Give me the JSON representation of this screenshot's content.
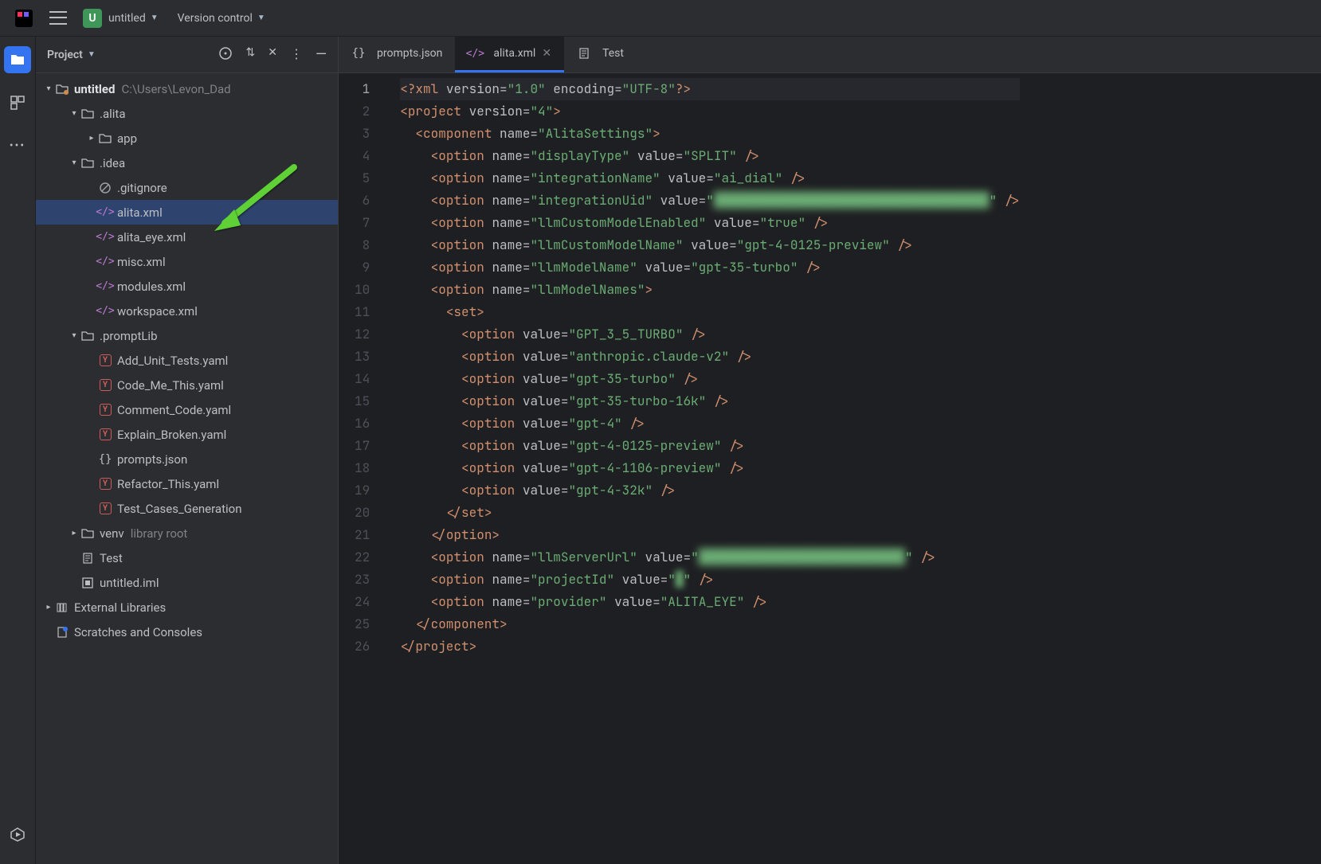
{
  "title": {
    "project": "untitled",
    "vcs": "Version control"
  },
  "leftbar": {
    "projectIcon": "folder-icon",
    "componentsIcon": "modules-icon",
    "moreIcon": "more-icon",
    "servicesIcon": "services-icon"
  },
  "panel": {
    "title": "Project"
  },
  "tree": {
    "root": {
      "label": "untitled",
      "hint": "C:\\Users\\Levon_Dad"
    },
    "items": [
      {
        "depth": 1,
        "arrow": "down",
        "icon": "folder",
        "label": ".alita"
      },
      {
        "depth": 2,
        "arrow": "right",
        "icon": "folder",
        "label": "app"
      },
      {
        "depth": 1,
        "arrow": "down",
        "icon": "folder",
        "label": ".idea"
      },
      {
        "depth": 2,
        "arrow": "",
        "icon": "ban",
        "label": ".gitignore"
      },
      {
        "depth": 2,
        "arrow": "",
        "icon": "xml",
        "label": "alita.xml",
        "selected": true
      },
      {
        "depth": 2,
        "arrow": "",
        "icon": "xml",
        "label": "alita_eye.xml"
      },
      {
        "depth": 2,
        "arrow": "",
        "icon": "xml",
        "label": "misc.xml"
      },
      {
        "depth": 2,
        "arrow": "",
        "icon": "xml",
        "label": "modules.xml"
      },
      {
        "depth": 2,
        "arrow": "",
        "icon": "xml",
        "label": "workspace.xml"
      },
      {
        "depth": 1,
        "arrow": "down",
        "icon": "folder",
        "label": ".promptLib"
      },
      {
        "depth": 2,
        "arrow": "",
        "icon": "yaml",
        "label": "Add_Unit_Tests.yaml"
      },
      {
        "depth": 2,
        "arrow": "",
        "icon": "yaml",
        "label": "Code_Me_This.yaml"
      },
      {
        "depth": 2,
        "arrow": "",
        "icon": "yaml",
        "label": "Comment_Code.yaml"
      },
      {
        "depth": 2,
        "arrow": "",
        "icon": "yaml",
        "label": "Explain_Broken.yaml"
      },
      {
        "depth": 2,
        "arrow": "",
        "icon": "json",
        "label": "prompts.json"
      },
      {
        "depth": 2,
        "arrow": "",
        "icon": "yaml",
        "label": "Refactor_This.yaml"
      },
      {
        "depth": 2,
        "arrow": "",
        "icon": "yaml",
        "label": "Test_Cases_Generation"
      },
      {
        "depth": 1,
        "arrow": "right",
        "icon": "folder",
        "label": "venv",
        "hint": "library root"
      },
      {
        "depth": 1,
        "arrow": "",
        "icon": "text",
        "label": "Test"
      },
      {
        "depth": 1,
        "arrow": "",
        "icon": "module",
        "label": "untitled.iml"
      }
    ],
    "extras": [
      {
        "arrow": "right",
        "icon": "lib",
        "label": "External Libraries"
      },
      {
        "arrow": "",
        "icon": "scratch",
        "label": "Scratches and Consoles"
      }
    ]
  },
  "tabs": [
    {
      "icon": "json",
      "label": "prompts.json",
      "active": false,
      "closeable": false
    },
    {
      "icon": "xml",
      "label": "alita.xml",
      "active": true,
      "closeable": true
    },
    {
      "icon": "text",
      "label": "Test",
      "active": false,
      "closeable": false
    }
  ],
  "code": {
    "lines": [
      {
        "html": "<span class='pi'>&lt;?</span><span class='t'>xml</span> <span class='a'>version=</span><span class='s'>\"1.0\"</span> <span class='a'>encoding=</span><span class='s'>\"UTF-8\"</span><span class='pi'>?&gt;</span>",
        "hl": true
      },
      {
        "html": "<span class='p'>&lt;</span><span class='t'>project</span> <span class='a'>version=</span><span class='s'>\"4\"</span><span class='p'>&gt;</span>"
      },
      {
        "html": "  <span class='p'>&lt;</span><span class='t'>component</span> <span class='a'>name=</span><span class='s'>\"AlitaSettings\"</span><span class='p'>&gt;</span>"
      },
      {
        "html": "    <span class='p'>&lt;</span><span class='t'>option</span> <span class='a'>name=</span><span class='s'>\"displayType\"</span> <span class='a'>value=</span><span class='s'>\"SPLIT\"</span> <span class='p'>/&gt;</span>"
      },
      {
        "html": "    <span class='p'>&lt;</span><span class='t'>option</span> <span class='a'>name=</span><span class='s'>\"integrationName\"</span> <span class='a'>value=</span><span class='s'>\"ai_dial\"</span> <span class='p'>/&gt;</span>"
      },
      {
        "html": "    <span class='p'>&lt;</span><span class='t'>option</span> <span class='a'>name=</span><span class='s'>\"integrationUid\"</span> <span class='a'>value=</span><span class='s'>\"<span style='filter:blur(5px);'>████████████████████████████████████</span>\"</span> <span class='p'>/&gt;</span>"
      },
      {
        "html": "    <span class='p'>&lt;</span><span class='t'>option</span> <span class='a'>name=</span><span class='s'>\"llmCustomModelEnabled\"</span> <span class='a'>value=</span><span class='s'>\"true\"</span> <span class='p'>/&gt;</span>"
      },
      {
        "html": "    <span class='p'>&lt;</span><span class='t'>option</span> <span class='a'>name=</span><span class='s'>\"llmCustomModelName\"</span> <span class='a'>value=</span><span class='s'>\"gpt-4-0125-preview\"</span> <span class='p'>/&gt;</span>"
      },
      {
        "html": "    <span class='p'>&lt;</span><span class='t'>option</span> <span class='a'>name=</span><span class='s'>\"llmModelName\"</span> <span class='a'>value=</span><span class='s'>\"gpt-35-turbo\"</span> <span class='p'>/&gt;</span>"
      },
      {
        "html": "    <span class='p'>&lt;</span><span class='t'>option</span> <span class='a'>name=</span><span class='s'>\"llmModelNames\"</span><span class='p'>&gt;</span>"
      },
      {
        "html": "      <span class='p'>&lt;</span><span class='t'>set</span><span class='p'>&gt;</span>"
      },
      {
        "html": "        <span class='p'>&lt;</span><span class='t'>option</span> <span class='a'>value=</span><span class='s'>\"GPT_3_5_TURBO\"</span> <span class='p'>/&gt;</span>"
      },
      {
        "html": "        <span class='p'>&lt;</span><span class='t'>option</span> <span class='a'>value=</span><span class='s'>\"anthropic.claude-v2\"</span> <span class='p'>/&gt;</span>"
      },
      {
        "html": "        <span class='p'>&lt;</span><span class='t'>option</span> <span class='a'>value=</span><span class='s'>\"gpt-35-turbo\"</span> <span class='p'>/&gt;</span>"
      },
      {
        "html": "        <span class='p'>&lt;</span><span class='t'>option</span> <span class='a'>value=</span><span class='s'>\"gpt-35-turbo-16k\"</span> <span class='p'>/&gt;</span>"
      },
      {
        "html": "        <span class='p'>&lt;</span><span class='t'>option</span> <span class='a'>value=</span><span class='s'>\"gpt-4\"</span> <span class='p'>/&gt;</span>"
      },
      {
        "html": "        <span class='p'>&lt;</span><span class='t'>option</span> <span class='a'>value=</span><span class='s'>\"gpt-4-0125-preview\"</span> <span class='p'>/&gt;</span>"
      },
      {
        "html": "        <span class='p'>&lt;</span><span class='t'>option</span> <span class='a'>value=</span><span class='s'>\"gpt-4-1106-preview\"</span> <span class='p'>/&gt;</span>"
      },
      {
        "html": "        <span class='p'>&lt;</span><span class='t'>option</span> <span class='a'>value=</span><span class='s'>\"gpt-4-32k\"</span> <span class='p'>/&gt;</span>"
      },
      {
        "html": "      <span class='p'>&lt;/</span><span class='t'>set</span><span class='p'>&gt;</span>"
      },
      {
        "html": "    <span class='p'>&lt;/</span><span class='t'>option</span><span class='p'>&gt;</span>"
      },
      {
        "html": "    <span class='p'>&lt;</span><span class='t'>option</span> <span class='a'>name=</span><span class='s'>\"llmServerUrl\"</span> <span class='a'>value=</span><span class='s'>\"<span style='filter:blur(5px);'>███████████████████████████</span>\"</span> <span class='p'>/&gt;</span>"
      },
      {
        "html": "    <span class='p'>&lt;</span><span class='t'>option</span> <span class='a'>name=</span><span class='s'>\"projectId\"</span> <span class='a'>value=</span><span class='s'>\"<span style='filter:blur(4px);'>█</span>\"</span> <span class='p'>/&gt;</span>"
      },
      {
        "html": "    <span class='p'>&lt;</span><span class='t'>option</span> <span class='a'>name=</span><span class='s'>\"provider\"</span> <span class='a'>value=</span><span class='s'>\"ALITA_EYE\"</span> <span class='p'>/&gt;</span>"
      },
      {
        "html": "  <span class='p'>&lt;/</span><span class='t'>component</span><span class='p'>&gt;</span>"
      },
      {
        "html": "<span class='p'>&lt;/</span><span class='t'>project</span><span class='p'>&gt;</span>"
      }
    ],
    "currentLine": 1
  }
}
